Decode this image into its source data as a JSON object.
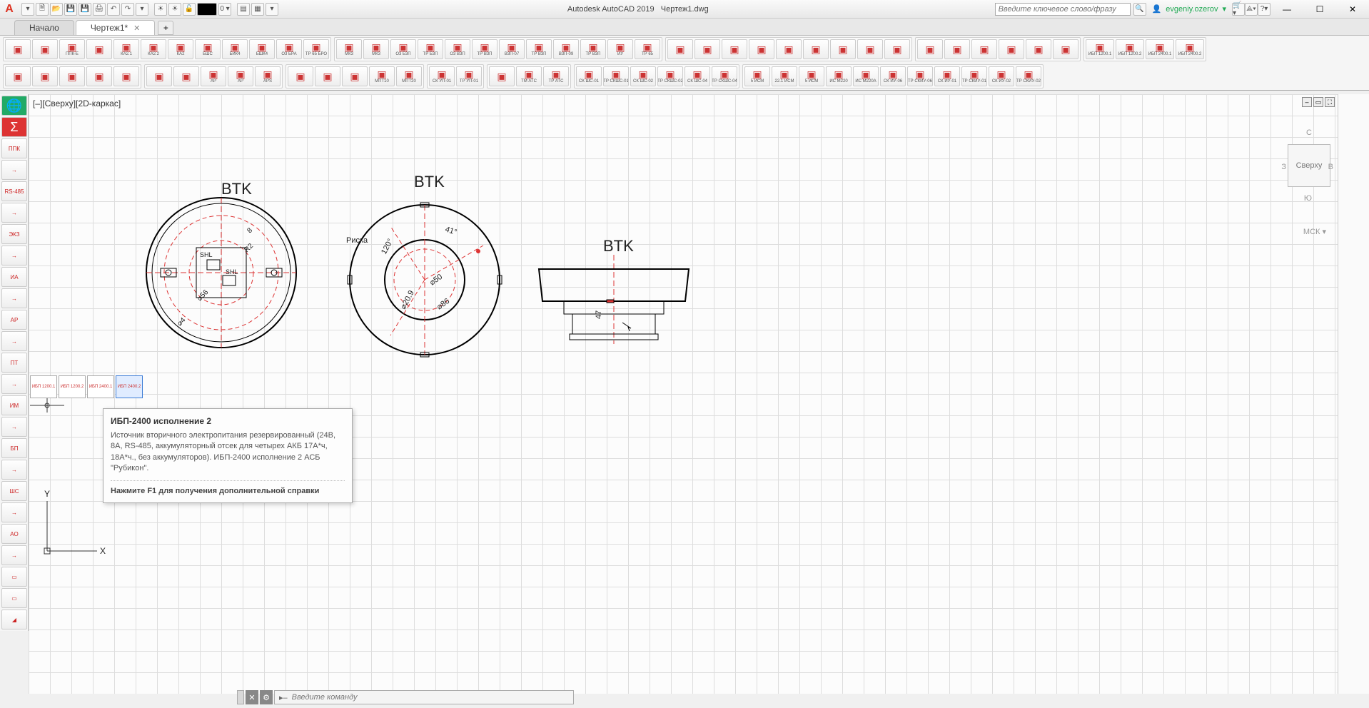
{
  "app": {
    "name": "Autodesk AutoCAD 2019",
    "doc": "Чертеж1.dwg"
  },
  "search": {
    "placeholder": "Введите ключевое слово/фразу"
  },
  "user": {
    "name": "evgeniy.ozerov"
  },
  "tabs": {
    "t0": "Начало",
    "t1": "Чертеж1*"
  },
  "viewport": {
    "label": "[–][Сверху][2D-каркас]",
    "viewcube": "Сверху",
    "compassN": "С",
    "compassS": "Ю",
    "compassE": "В",
    "compassW": "З",
    "wcs": "МСК ▾",
    "axisY": "Y",
    "axisX": "X"
  },
  "tooltip": {
    "title": "ИБП-2400 исполнение 2",
    "body": "Источник вторичного электропитания резервированный (24В, 8А, RS-485, аккумуляторный отсек для четырех  АКБ 17А*ч, 18А*ч., без аккумуляторов). ИБП-2400 исполнение 2 АСБ \"Рубикон\".",
    "hint": "Нажмите F1 для получения дополнительной справки"
  },
  "cmd": {
    "prompt": "Введите команду",
    "marker": "▸–"
  },
  "tbrow1": [
    "",
    "",
    "ППК-Е",
    "",
    "КА2.1",
    "КА2.2",
    "КА2",
    "БШС",
    "БИК4",
    "БШК4",
    "О3 БРА",
    "ТР 65 БРО"
  ],
  "tbrow1b": [
    "МК3",
    "МК3",
    "О3 Б3П",
    "ТР Б3П",
    "О3 В3П",
    "ТР В3П",
    "В3П-07",
    "ТР В3П",
    "В3П-09",
    "ТР В3П",
    "ИУ",
    "ТР 65"
  ],
  "tbrow1c": [
    "",
    "",
    "",
    "",
    "",
    "",
    "",
    "",
    ""
  ],
  "tbrow1d": [
    "",
    "",
    "",
    "",
    "",
    ""
  ],
  "tbrow1e": [
    "ИБП 1200.1",
    "ИБП 1200.2",
    "ИБП 2400.1",
    "ИБП 2400.2"
  ],
  "tbrow2": [
    "",
    "",
    "",
    "",
    ""
  ],
  "tbrow2b": [
    "",
    "",
    "АР",
    "АР",
    "APS"
  ],
  "tbrow2c": [
    "",
    "",
    "",
    "МПТ10",
    "МПТ20"
  ],
  "tbrow2d": [
    "СК УП-01",
    "ТР УП-01"
  ],
  "tbrow2e": [
    "",
    "ТМ АТС",
    "ТР АТС"
  ],
  "tbrow2f": [
    "СК ШС-01",
    "ТР СКШС-01",
    "СК ШС-02",
    "ТР СКШС-02",
    "СК ШС-04",
    "ТР СКШС-04"
  ],
  "tbrow2g": [
    "5 ИСМ",
    "22.1 ИСМ",
    "5 ИСМ",
    "ИС М220",
    "ИС М220А",
    "СК ИУ-06",
    "ТР СКИУ-06",
    "СК ИУ-01",
    "ТР СКИУ-01",
    "СК ИУ-02",
    "ТР СКИУ-02"
  ],
  "leftbar": [
    "🌐",
    "Σ",
    "ППК",
    "→",
    "RS-485",
    "→",
    "ЭКЗ",
    "→",
    "ИА",
    "→",
    "АР",
    "→",
    "ПТ",
    "→",
    "ИМ",
    "→",
    "БП",
    "→",
    "ШС",
    "→",
    "АО",
    "→",
    "▭",
    "▭",
    "◢"
  ],
  "thumbs": [
    "ИБП 1200.1",
    "ИБП 1200.2",
    "ИБП 2400.1",
    "ИБП 2400.2"
  ],
  "drawing": {
    "btk1": "BTK",
    "btk2": "BTK",
    "btk3": "BTK",
    "shl1": "SHL",
    "shl2": "SHL",
    "risk": "Риска",
    "ang120": "120°",
    "ang41": "41°",
    "d50": "⌀50",
    "d86": "⌀86",
    "d56": "⌀56",
    "d4": "⌀4",
    "d209": "⌀20.9",
    "r88": "8",
    "r2": "R2",
    "h47": "47"
  }
}
